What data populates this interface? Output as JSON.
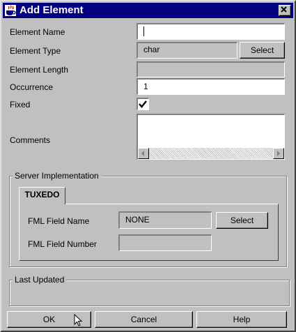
{
  "window": {
    "title": "Add Element",
    "icon": "coffee-cup-icon",
    "close_icon": "close-icon"
  },
  "form": {
    "element_name": {
      "label": "Element Name",
      "value": ""
    },
    "element_type": {
      "label": "Element Type",
      "value": "char",
      "button": "Select"
    },
    "element_length": {
      "label": "Element Length",
      "value": ""
    },
    "occurrence": {
      "label": "Occurrence",
      "value": "1"
    },
    "fixed": {
      "label": "Fixed",
      "checked": true
    },
    "comments": {
      "label": "Comments",
      "value": ""
    }
  },
  "server": {
    "legend": "Server Implementation",
    "tab": "TUXEDO",
    "fml_field_name": {
      "label": "FML Field Name",
      "value": "NONE",
      "button": "Select"
    },
    "fml_field_number": {
      "label": "FML Field Number",
      "value": ""
    }
  },
  "last_updated": {
    "legend": "Last Updated"
  },
  "buttons": {
    "ok": "OK",
    "cancel": "Cancel",
    "help": "Help"
  },
  "colors": {
    "face": "#c0c0c0",
    "titlebar": "#000080"
  }
}
